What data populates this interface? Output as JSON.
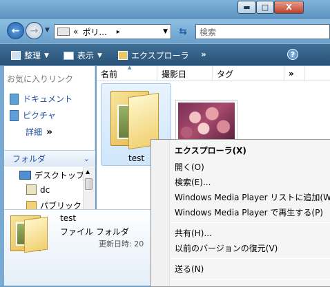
{
  "titlebar": {
    "minimize_glyph": "▬",
    "maximize_glyph": "□",
    "close_glyph": "X"
  },
  "address": {
    "path_prefix": "«",
    "path": "ポリ...",
    "separator": "▸"
  },
  "search": {
    "placeholder": "検索"
  },
  "toolbar": {
    "organize": "整理",
    "views": "表示",
    "explorer": "エクスプローラ",
    "overflow": "»",
    "help": "?"
  },
  "nav": {
    "favorites_header": "お気に入りリンク",
    "favorites": [
      {
        "label": "ドキュメント"
      },
      {
        "label": "ピクチャ"
      }
    ],
    "more_label": "詳細",
    "more_chevron": "»",
    "folders_header": "フォルダ",
    "tree": [
      {
        "label": "デスクトップ"
      },
      {
        "label": "dc"
      },
      {
        "label": "パブリック"
      }
    ]
  },
  "columns": {
    "name": "名前",
    "date_taken": "撮影日",
    "tags": "タグ",
    "more": "»"
  },
  "files": [
    {
      "name": "test",
      "icon": "folder-icon"
    },
    {
      "name": "",
      "icon": "flower-photo-thumbnail"
    }
  ],
  "details": {
    "name": "test",
    "type": "ファイル フォルダ",
    "modified_label": "更新日時: 20"
  },
  "context_menu": {
    "items": [
      {
        "label": "エクスプローラ(X)",
        "bold": true
      },
      {
        "label": "開く(O)"
      },
      {
        "label": "検索(E)..."
      },
      {
        "label": "Windows Media Player リストに追加(W)"
      },
      {
        "label": "Windows Media Player で再生する(P)"
      },
      {
        "label": "共有(H)..."
      },
      {
        "label": "以前のバージョンの復元(V)"
      },
      {
        "label": "送る(N)"
      }
    ]
  },
  "colors": {
    "accent_blue": "#1f4e9a",
    "toolbar_bg": "#2f5a80",
    "selection_bg": "#dbecfb"
  }
}
